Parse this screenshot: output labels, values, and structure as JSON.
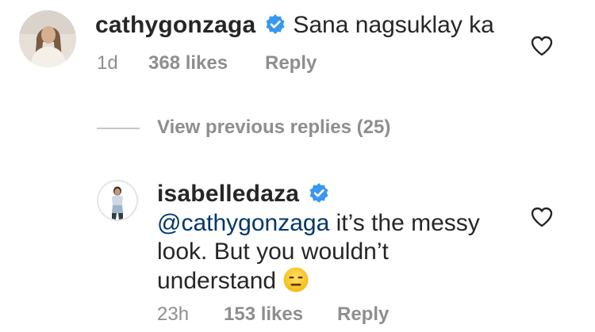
{
  "comments": [
    {
      "username": "cathygonzaga",
      "verified": true,
      "text": "Sana nagsuklay ka",
      "time": "1d",
      "likes": "368 likes",
      "reply_label": "Reply"
    },
    {
      "username": "isabelledaza",
      "verified": true,
      "mention": "@cathygonzaga",
      "text_line1_rest": " it’s the messy",
      "text_line2": "look. But you wouldn’t",
      "text_line3": "understand",
      "emoji": "😑",
      "time": "23h",
      "likes": "153 likes",
      "reply_label": "Reply"
    }
  ],
  "replies_toggle": {
    "label": "View previous replies (25)"
  },
  "colors": {
    "text": "#262626",
    "secondary": "#8e8e8e",
    "mention": "#00376b",
    "verified": "#3897f0"
  },
  "icons": {
    "verified": "verified-badge-icon",
    "like": "heart-outline-icon"
  }
}
